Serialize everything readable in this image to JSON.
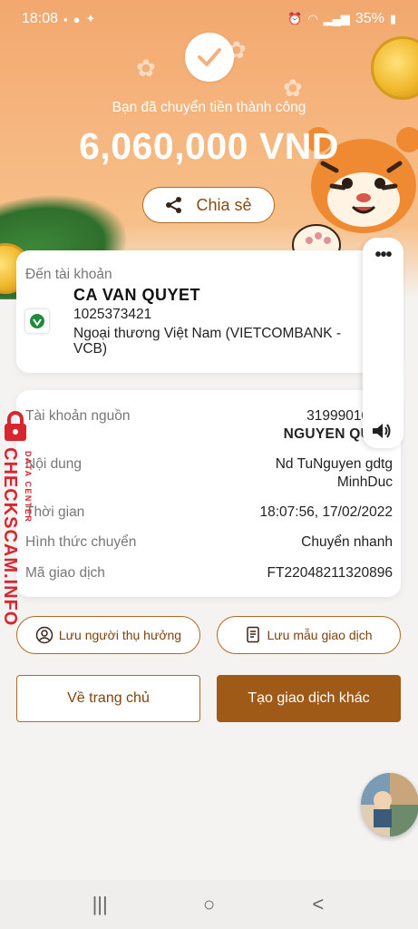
{
  "status_bar": {
    "time": "18:08",
    "battery": "35%",
    "icons": [
      "message-icon",
      "messenger-icon",
      "camera-icon",
      "twitter-icon",
      "alarm-icon",
      "wifi-icon",
      "signal-icon",
      "battery-icon"
    ]
  },
  "header": {
    "success_message": "Bạn đã chuyển tiền thành công",
    "amount": "6,060,000 VND",
    "share_label": "Chia sẻ",
    "icons": [
      "check-icon",
      "share-icon"
    ]
  },
  "recipient": {
    "label": "Đến tài khoản",
    "name": "CA VAN QUYET",
    "account": "1025373421",
    "bank": "Ngoại thương Việt Nam (VIETCOMBANK - VCB)",
    "bank_logo": "vietcombank-logo"
  },
  "details": {
    "rows": [
      {
        "label": "Tài khoản nguồn",
        "value": "31999010977"
      },
      {
        "label": "",
        "value": "NGUYEN QUOC"
      },
      {
        "label": "Nội dung",
        "value": "Nd TuNguyen gdtg"
      },
      {
        "label": "",
        "value": "MinhDuc"
      },
      {
        "label": "Thời gian",
        "value": "18:07:56, 17/02/2022"
      },
      {
        "label": "Hình thức chuyển",
        "value": "Chuyển nhanh"
      },
      {
        "label": "Mã giao dịch",
        "value": "FT22048211320896"
      }
    ]
  },
  "side_panel": {
    "more_label": "•••",
    "speaker_icon": "speaker-icon"
  },
  "watermark": {
    "text": "CHECKSCAM.INFO",
    "sub": "DATA CENTER"
  },
  "actions": {
    "save_beneficiary": "Lưu người thụ hưởng",
    "save_template": "Lưu mẫu giao dịch",
    "home": "Về trang chủ",
    "new_transaction": "Tạo giao dịch khác"
  },
  "navbar": {
    "recents": "|||",
    "home": "○",
    "back": "<"
  },
  "colors": {
    "accent": "#a05a17",
    "outline": "#b06a23",
    "banner": "#f6b57e",
    "watermark": "#d8262e"
  }
}
